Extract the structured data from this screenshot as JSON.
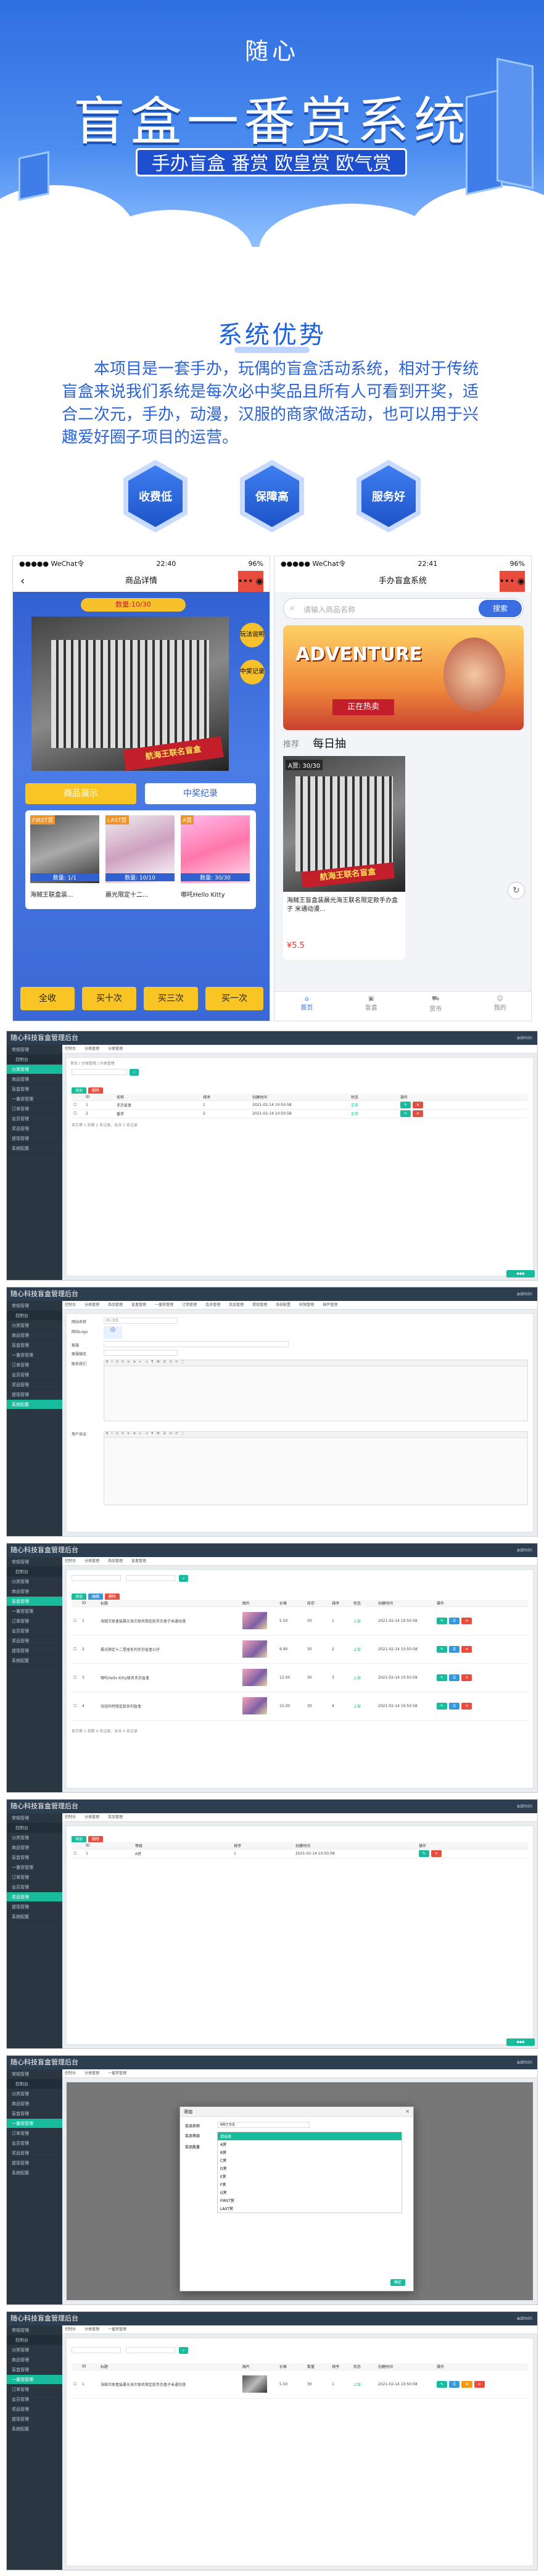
{
  "hero": {
    "brand": "随心",
    "title": "盲盒一番赏系统",
    "tagline": "手办盲盒 番赏 欧皇赏 欧气赏"
  },
  "intro": {
    "heading": "系统优势",
    "body": "本项目是一套手办，玩偶的盲盒活动系统，相对于传统盲盒来说我们系统是每次必中奖品且所有人可看到开奖，适合二次元，手办，动漫，汉服的商家做活动，也可以用于兴趣爱好圈子项目的运营。",
    "features": [
      "收费低",
      "保障高",
      "服务好"
    ]
  },
  "phone1": {
    "status_left": "●●●●● WeChat令",
    "time": "22:40",
    "battery": "96%",
    "title": "商品详情",
    "badge_top": "数量:10/30",
    "price_tag": "¥5.50",
    "tab_left": "商品展示",
    "tab_right": "中奖纪录",
    "side_labels": [
      "玩法说明",
      "中奖记录"
    ],
    "banner": "航海王联名盲盒",
    "items": [
      {
        "tag": "FIRST赏",
        "count": "数量: 1/1"
      },
      {
        "tag": "LAST赏",
        "count": "数量: 10/10"
      },
      {
        "tag": "A赏",
        "count": "数量: 30/30"
      }
    ],
    "item_names": [
      "海贼王联盒装...",
      "晨光限定十二...",
      "哪吒Hello Kitty"
    ],
    "buttons": [
      "全收",
      "买十次",
      "买三次",
      "买一次"
    ]
  },
  "phone2": {
    "status_left": "●●●●● WeChat令",
    "time": "22:41",
    "battery": "96%",
    "title": "手办盲盒系统",
    "search_placeholder": "请输入商品名称",
    "search_btn": "搜索",
    "banner_title": "ADVENTURE",
    "banner_btn": "正在热卖",
    "tabs": [
      "推荐",
      "每日抽"
    ],
    "stock": "A赏: 30/30",
    "card_name": "海贼王盲盒装晨光海王联名限定款手办盒子 米通动漫...",
    "card_price": "¥5.5",
    "nav": [
      "首页",
      "盲盒",
      "赏市",
      "我的"
    ]
  },
  "admin_brand": "随心科技盲盒管理后台",
  "admin_user": "admin",
  "sidebar": [
    "常规管理",
    "控制台",
    "分类管理",
    "商品管理",
    "盲盒管理",
    "一番赏管理",
    "订单管理",
    "会员管理",
    "奖品管理",
    "提现管理",
    "系统配置"
  ],
  "admin1": {
    "tabs": [
      "控制台",
      "分类管理",
      "分类管理"
    ],
    "crumb": "首页 / 分类管理 / 分类管理",
    "buttons": [
      "添加",
      "删除"
    ],
    "headers": [
      "",
      "ID",
      "名称",
      "排序",
      "创建时间",
      "状态",
      "操作"
    ],
    "rows": [
      [
        "1",
        "手办盲盒",
        "1",
        "2021-02-14 10:50:58",
        "正常"
      ],
      [
        "2",
        "番赏",
        "2",
        "2021-02-14 10:50:58",
        "正常"
      ]
    ],
    "footer": "显示第 1 到第 2 条记录，总共 2 条记录"
  },
  "admin2": {
    "tabs": [
      "控制台",
      "分类管理",
      "商品管理",
      "盲盒管理",
      "一番赏管理",
      "订单管理",
      "会员管理",
      "奖品管理",
      "提现管理",
      "系统配置",
      "权限管理",
      "插件管理"
    ],
    "labels": [
      "网站名称",
      "网站Logo",
      "客服",
      "客服微信",
      "联系我们",
      "用户协议",
      "隐私协议"
    ],
    "site_name": "随心盲盒"
  },
  "admin3": {
    "tabs": [
      "控制台",
      "分类管理",
      "商品管理",
      "盲盒管理"
    ],
    "buttons": [
      "添加",
      "编辑",
      "删除"
    ],
    "headers": [
      "",
      "ID",
      "标题",
      "图片",
      "价格",
      "库存",
      "排序",
      "状态",
      "创建时间",
      "操作"
    ],
    "rows": [
      [
        "1",
        "海贼王联盒装晨光海王联名限定款手办盒子米通动漫",
        "5.50",
        "30",
        "1",
        "上架",
        "2021-02-14 10:50:58"
      ],
      [
        "2",
        "晨光限定十二星座系列手办盲盒公仔",
        "9.90",
        "30",
        "2",
        "上架",
        "2021-02-14 10:50:58"
      ],
      [
        "3",
        "哪吒Hello Kitty联名手办盲盒",
        "12.00",
        "30",
        "3",
        "上架",
        "2021-02-14 10:50:58"
      ],
      [
        "4",
        "泡泡玛特限定款系列盲盒",
        "15.00",
        "30",
        "4",
        "上架",
        "2021-02-14 10:50:58"
      ]
    ],
    "footer": "显示第 1 到第 4 条记录，总共 4 条记录"
  },
  "admin4": {
    "tabs": [
      "控制台",
      "分类管理",
      "奖品管理"
    ],
    "buttons": [
      "添加",
      "删除"
    ],
    "headers": [
      "",
      "ID",
      "等级",
      "排序",
      "创建时间",
      "操作"
    ],
    "rows": [
      [
        "1",
        "A赏",
        "1",
        "2021-02-14 10:50:58"
      ]
    ]
  },
  "admin5": {
    "tabs": [
      "控制台",
      "分类管理",
      "一番赏管理"
    ],
    "dialog_title": "添加",
    "dialog_labels": [
      "奖品名称",
      "奖品等级",
      "奖品数量"
    ],
    "dialog_value": "海贼王盲盒",
    "options": [
      "请选择",
      "A赏",
      "B赏",
      "C赏",
      "D赏",
      "E赏",
      "F赏",
      "G赏",
      "FIRST赏",
      "LAST赏"
    ],
    "confirm": "确定"
  },
  "admin6": {
    "tabs": [
      "控制台",
      "分类管理",
      "一番赏管理"
    ],
    "headers": [
      "",
      "ID",
      "标题",
      "图片",
      "价格",
      "数量",
      "排序",
      "状态",
      "创建时间",
      "操作"
    ],
    "rows": [
      [
        "1",
        "海贼王联盒装晨光海王联名限定款手办盒子米通动漫",
        "5.50",
        "30",
        "1",
        "上架",
        "2021-02-14 10:50:58"
      ]
    ]
  }
}
